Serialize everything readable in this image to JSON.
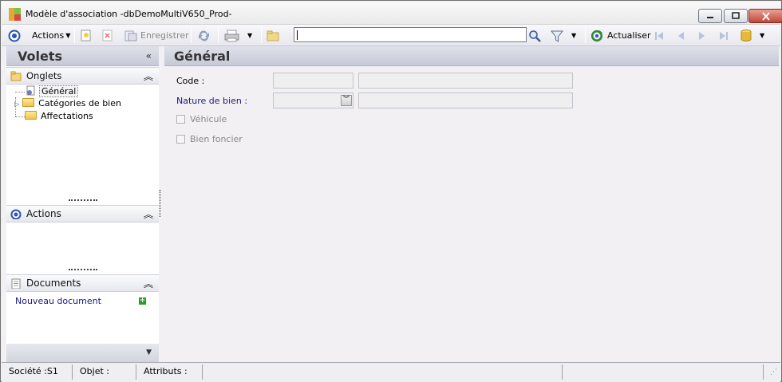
{
  "window": {
    "title": "Modèle d'association -dbDemoMultiV650_Prod-"
  },
  "toolbar": {
    "actions_label": "Actions",
    "save_label": "Enregistrer",
    "search_value": "",
    "refresh_label": "Actualiser"
  },
  "sidebar": {
    "title": "Volets",
    "collapse_glyph": "«",
    "onglets": {
      "title": "Onglets",
      "items": [
        {
          "label": "Général",
          "selected": true
        },
        {
          "label": "Catégories de bien",
          "selected": false
        },
        {
          "label": "Affectations",
          "selected": false
        }
      ]
    },
    "actions": {
      "title": "Actions"
    },
    "documents": {
      "title": "Documents",
      "new_document": "Nouveau document"
    }
  },
  "main": {
    "title": "Général",
    "form": {
      "code_label": "Code :",
      "code_value": "",
      "code_desc": "",
      "nature_label": "Nature de bien :",
      "nature_value": "",
      "nature_desc": "",
      "vehicule_label": "Véhicule",
      "vehicule_checked": false,
      "bien_foncier_label": "Bien foncier",
      "bien_foncier_checked": false
    }
  },
  "status": {
    "societe": "Société :S1",
    "objet": "Objet :",
    "attributs": "Attributs :"
  },
  "colors": {
    "link": "#1a1a80",
    "accent": "#2a55b0",
    "close_button": "#c3453a"
  }
}
